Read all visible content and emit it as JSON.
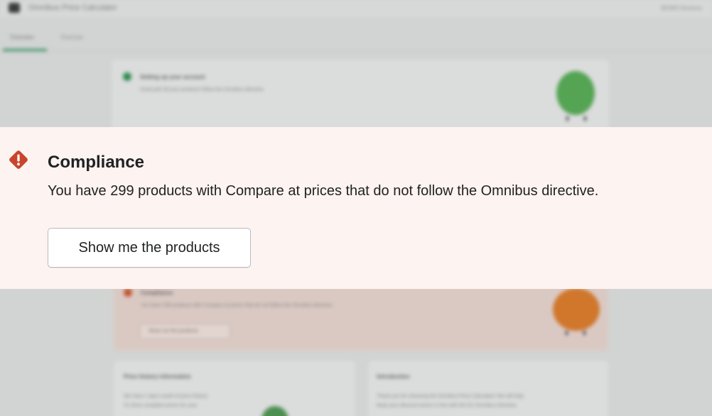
{
  "app": {
    "title": "Omnibus Price Calculator",
    "user": "BOWN Services"
  },
  "tabs": [
    {
      "label": "Overview"
    },
    {
      "label": "Exercise"
    }
  ],
  "setup_card": {
    "title": "Setting up your account",
    "text": "Great job! All your products follow the Omnibus directive"
  },
  "compliance_card": {
    "title": "Compliance",
    "text": "You have 299 products with Compare at prices that do not follow the Omnibus directive.",
    "button_label": "Show me the products"
  },
  "price_history_card": {
    "title": "Price history information",
    "text_line1": "We have 1 day's worth of price history.",
    "text_line2": "To show compliant prices for your"
  },
  "intro_card": {
    "title": "Introduction",
    "text_line1": "Thank you for choosing the Omnibus Price Calculator! We will help",
    "text_line2": "keep your discount prices in line with the EU Omnibus Directive."
  },
  "banner": {
    "title": "Compliance",
    "message": "You have 299 products with Compare at prices that do not follow the Omnibus directive.",
    "button_label": "Show me the products",
    "icon": "alert-diamond-icon",
    "icon_color": "#c8452b"
  },
  "colors": {
    "success": "#2f8c4e",
    "critical": "#c8452b",
    "banner_bg": "#fdf3f1"
  }
}
